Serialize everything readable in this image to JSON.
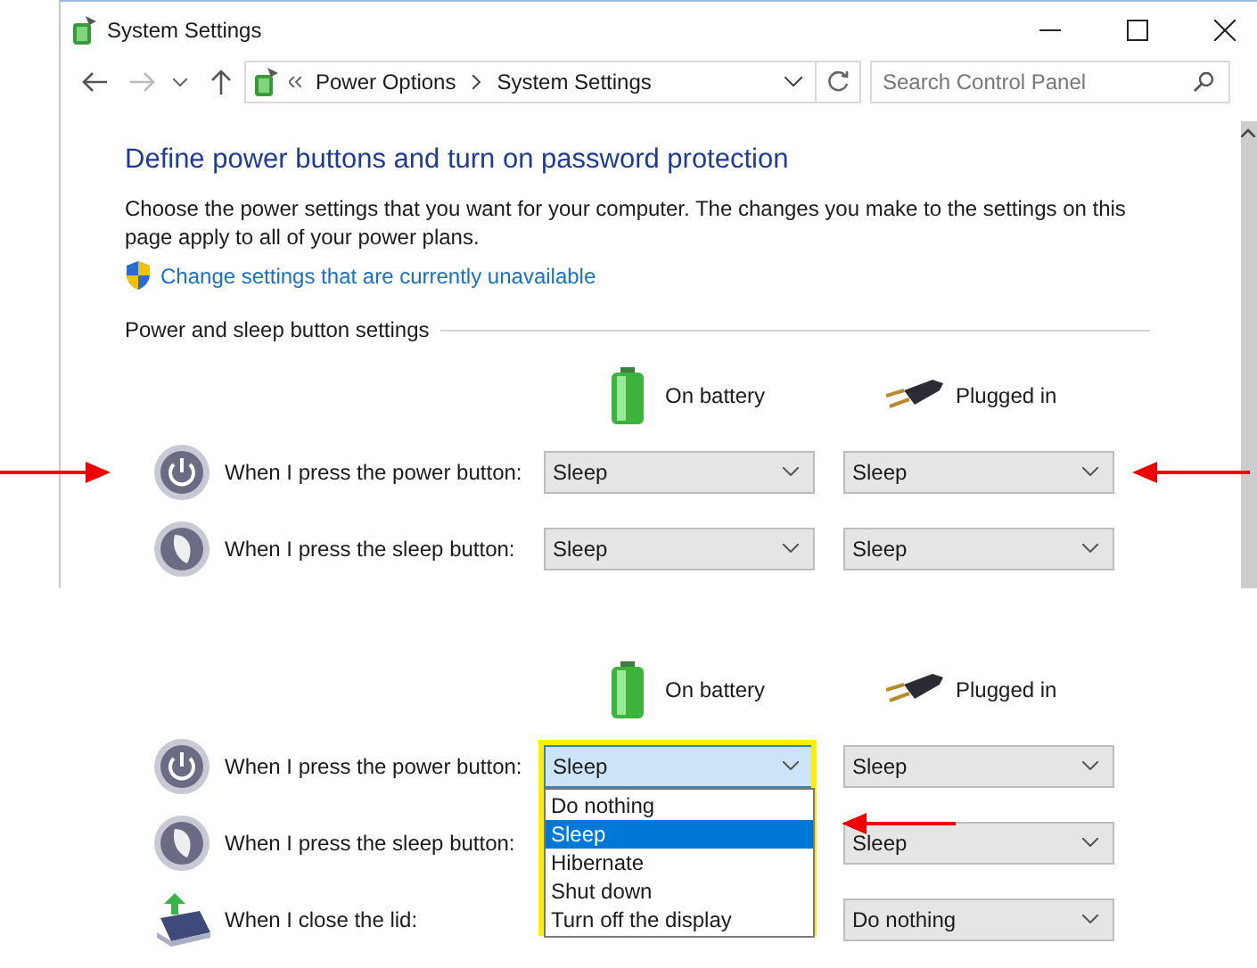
{
  "window": {
    "title": "System Settings"
  },
  "address_bar": {
    "breadcrumbs": [
      "Power Options",
      "System Settings"
    ]
  },
  "search": {
    "placeholder": "Search Control Panel"
  },
  "heading": "Define power buttons and turn on password protection",
  "description": "Choose the power settings that you want for your computer. The changes you make to the settings on this page apply to all of your power plans.",
  "link": "Change settings that are currently unavailable",
  "section_title": "Power and sleep button settings",
  "settings": {
    "columns": [
      {
        "kind": "battery",
        "label": "On battery"
      },
      {
        "kind": "plug",
        "label": "Plugged in"
      }
    ],
    "rows": [
      {
        "kind": "power",
        "label": "When I press the power button:",
        "on_battery": {
          "value": "Sleep"
        },
        "plugged_in": {
          "value": "Sleep"
        }
      },
      {
        "kind": "sleep",
        "label": "When I press the sleep button:",
        "on_battery": {
          "value": "Sleep"
        },
        "plugged_in": {
          "value": "Sleep"
        }
      }
    ]
  },
  "zoomed_view": {
    "columns": [
      {
        "kind": "battery",
        "label": "On battery"
      },
      {
        "kind": "plug",
        "label": "Plugged in"
      }
    ],
    "rows": [
      {
        "kind": "power",
        "label": "When I press the power button:",
        "on_battery": {
          "value": "Sleep",
          "open": true,
          "options": [
            {
              "label": "Do nothing",
              "selected": false
            },
            {
              "label": "Sleep",
              "selected": true
            },
            {
              "label": "Hibernate",
              "selected": false
            },
            {
              "label": "Shut down",
              "selected": false
            },
            {
              "label": "Turn off the display",
              "selected": false
            }
          ]
        },
        "plugged_in": {
          "value": "Sleep"
        }
      },
      {
        "kind": "sleep",
        "label": "When I press the sleep button:",
        "plugged_in": {
          "value": "Sleep"
        }
      },
      {
        "kind": "lid",
        "label": "When I close the lid:",
        "plugged_in": {
          "value": "Do nothing"
        }
      }
    ]
  }
}
